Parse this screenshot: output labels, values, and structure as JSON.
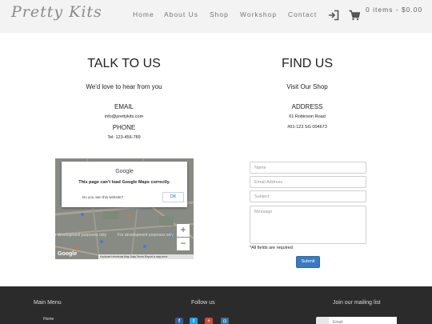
{
  "header": {
    "logo": "Pretty Kits",
    "nav": [
      "Home",
      "About Us",
      "Shop",
      "Workshop",
      "Contact"
    ],
    "cart": "0 items - $0.00",
    "login_icon": "login-icon",
    "cart_icon": "cart-icon"
  },
  "talk": {
    "title": "TALK TO US",
    "subtitle": "We'd love to hear from you",
    "email_label": "EMAIL",
    "email": "info@prettykits.com",
    "phone_label": "PHONE",
    "phone": "Tel: 123-456-789"
  },
  "find": {
    "title": "FIND US",
    "subtitle": "Visit Our Shop",
    "address_label": "ADDRESS",
    "address1": "61 Robinson Road",
    "address2": "#01-123 SG 004673"
  },
  "map": {
    "brand": "Google",
    "error": "This page can't load Google Maps correctly.",
    "own_question": "Do you own this website?",
    "ok": "OK",
    "dev_text": "For development purposes only",
    "zoom_in": "+",
    "zoom_out": "−",
    "footer": "Keyboard shortcuts   Map Data   Terms   Report a map error",
    "logo": "Google"
  },
  "form": {
    "name_placeholder": "Name",
    "email_placeholder": "Email Address",
    "subject_placeholder": "Subject",
    "message_placeholder": "Message",
    "required_note": "*All fields are required",
    "submit": "Submit"
  },
  "footer": {
    "main_menu": "Main Menu",
    "home_link": "Home",
    "follow": "Follow us",
    "mailing": "Join our mailing list",
    "email_placeholder": "Email",
    "social": [
      {
        "icon": "facebook-icon",
        "glyph": "f",
        "color": "#3b5998"
      },
      {
        "icon": "twitter-icon",
        "glyph": "t",
        "color": "#1da1f2"
      },
      {
        "icon": "google-plus-icon",
        "glyph": "+",
        "color": "#d34836"
      },
      {
        "icon": "instagram-icon",
        "glyph": "◘",
        "color": "#3f729b"
      }
    ]
  },
  "colors": {
    "header_bg": "#f3f3f3",
    "footer_bg": "#2b2b2b",
    "submit": "#3a7ac0"
  }
}
